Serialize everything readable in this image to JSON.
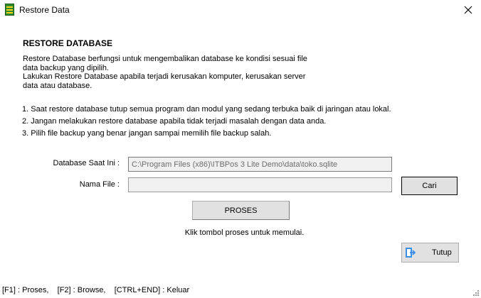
{
  "window": {
    "title": "Restore Data"
  },
  "heading": "RESTORE DATABASE",
  "description": "Restore Database berfungsi untuk mengembalikan database ke kondisi sesuai file\ndata backup yang dipilih.\nLakukan Restore Database apabila terjadi kerusakan komputer, kerusakan server\ndata atau database.",
  "steps": [
    "1. Saat restore database tutup semua program dan modul yang sedang terbuka baik di jaringan atau lokal.",
    "2. Jangan melakukan restore database apabila tidak terjadi masalah dengan data anda.",
    "3. Pilih file backup yang benar jangan sampai memilih file backup salah."
  ],
  "form": {
    "database_label": "Database Saat Ini :",
    "database_value": "C:\\Program Files (x86)\\ITBPos 3 Lite Demo\\data\\toko.sqlite",
    "file_label": "Nama File :",
    "file_value": "",
    "browse_label": "Cari"
  },
  "process_label": "PROSES",
  "hint": "Klik tombol proses untuk memulai.",
  "close_label": "Tutup",
  "footer": "[F1] : Proses,    [F2] : Browse,    [CTRL+END] : Keluar",
  "colors": {
    "icon_green": "#2f8a2c",
    "icon_yellow": "#ffd21f",
    "button_bg": "#e1e1e1",
    "exit_icon_blue": "#3a8ee6"
  }
}
